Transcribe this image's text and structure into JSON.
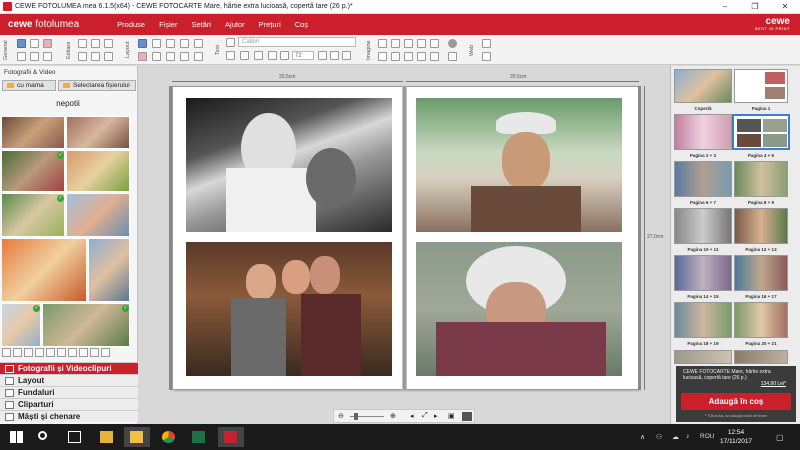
{
  "window": {
    "title": "CEWE FOTOLUMEA mea 6.1.5(x64) - CEWE FOTOCARTE Mare, hârtie extra lucioasă, copertă tare (26 p.)*",
    "controls": [
      "–",
      "❐",
      "✕"
    ]
  },
  "menubar": {
    "logo_bold": "cewe",
    "logo_rest": " fotolumea",
    "items": [
      "Produse",
      "Fișier",
      "Setări",
      "Ajutor",
      "Prețuri",
      "Coș"
    ],
    "brand": "cewe",
    "brand_tag": "BEST IN PRINT"
  },
  "toolbar": {
    "groups": [
      "General",
      "Editare",
      "Layout",
      "Text",
      "Imagine",
      "Web"
    ],
    "font_placeholder": "Calibri",
    "font_size": "72"
  },
  "left_panel": {
    "title": "Fotografii & Video",
    "folder_button": "cu mama",
    "select_files_button": "Selectarea fișierului",
    "folder_name": "nepotii",
    "categories": [
      "Fotografii și Videoclipuri",
      "Layout",
      "Fundaluri",
      "Cliparturi",
      "Măști și chenare"
    ]
  },
  "canvas": {
    "ruler_left": "20,5cm",
    "ruler_right": "20,5cm",
    "ruler_height": "27,0cm"
  },
  "right_panel": {
    "pages": [
      "Copertă",
      "Pagina 1",
      "Pagina 2 + 3",
      "Pagina 4 + 5",
      "Pagina 6 + 7",
      "Pagina 8 + 9",
      "Pagina 10 + 11",
      "Pagina 12 + 13",
      "Pagina 14 + 15",
      "Pagina 16 + 17",
      "Pagina 18 + 19",
      "Pagina 20 + 21"
    ],
    "order_title": "CEWE FOTOCARTE Mare, hârtie extra lucioasă, copertă tare (26 p.)",
    "order_price": "134,90 Lei*",
    "add_to_cart": "Adaugă în coș",
    "order_note": "* TVA inclus, se adaugă costul de livrare"
  },
  "taskbar": {
    "time": "12:54",
    "date": "17/11/2017",
    "lang": "ROU"
  },
  "colors": {
    "accent": "#cc1f2c",
    "selection": "#3c7fd0"
  }
}
